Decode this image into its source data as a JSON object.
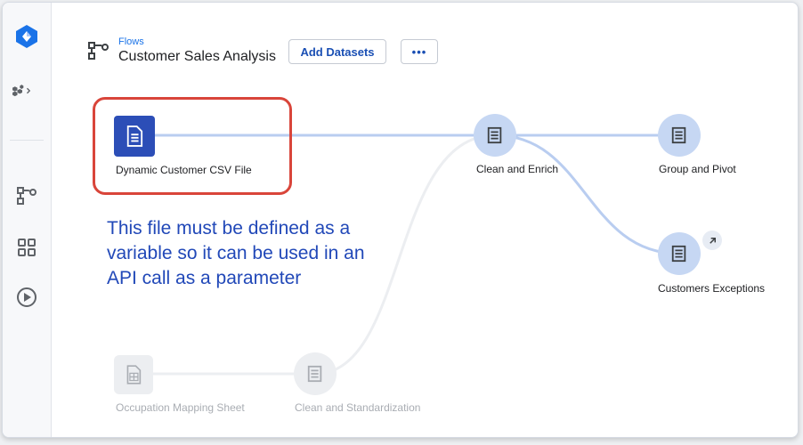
{
  "sidebar": {
    "logo_icon": "dataprep-logo-icon",
    "items": [
      {
        "name": "datasets-icon"
      },
      {
        "name": "flow-icon"
      },
      {
        "name": "apps-grid-icon"
      },
      {
        "name": "jobs-play-icon"
      }
    ]
  },
  "header": {
    "breadcrumb": "Flows",
    "title": "Customer Sales Analysis",
    "add_datasets_label": "Add Datasets",
    "more_label": "•••"
  },
  "nodes": {
    "dynamic_csv": "Dynamic Customer CSV File",
    "clean_enrich": "Clean and Enrich",
    "group_pivot": "Group and Pivot",
    "customer_exceptions": "Customers Exceptions",
    "occupation_sheet": "Occupation Mapping Sheet",
    "clean_standardization": "Clean and Standardization"
  },
  "annotation": {
    "line1": "This file must be defined as a",
    "line2": "variable so it can be used in an",
    "line3": "API call as a parameter"
  },
  "colors": {
    "accent": "#1a73e8",
    "node_dark": "#2c4eb7",
    "node_light": "#c6d7f3",
    "highlight": "#d9453a",
    "annotation": "#2148b8"
  }
}
